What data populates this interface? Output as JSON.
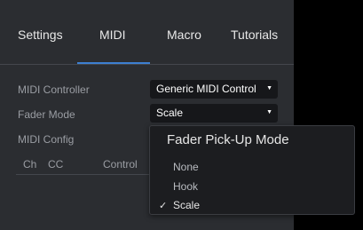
{
  "tabs": [
    {
      "label": "Settings"
    },
    {
      "label": "MIDI"
    },
    {
      "label": "Macro"
    },
    {
      "label": "Tutorials"
    }
  ],
  "active_tab": "MIDI",
  "rows": {
    "controller": {
      "label": "MIDI Controller",
      "value": "Generic MIDI Control"
    },
    "fader_mode": {
      "label": "Fader Mode",
      "value": "Scale"
    },
    "config": {
      "label": "MIDI Config"
    }
  },
  "table": {
    "columns": [
      "Ch",
      "CC",
      "Control"
    ]
  },
  "popup": {
    "title": "Fader Pick-Up Mode",
    "options": [
      {
        "label": "None",
        "checked": false
      },
      {
        "label": "Hook",
        "checked": false
      },
      {
        "label": "Scale",
        "checked": true
      }
    ],
    "check_glyph": "✓"
  },
  "colors": {
    "panel_bg": "#2b2d31",
    "accent": "#3d7fd1",
    "select_bg": "#16171a"
  },
  "icons": {
    "dropdown": "caret-down-icon",
    "selected": "checkmark-icon"
  }
}
